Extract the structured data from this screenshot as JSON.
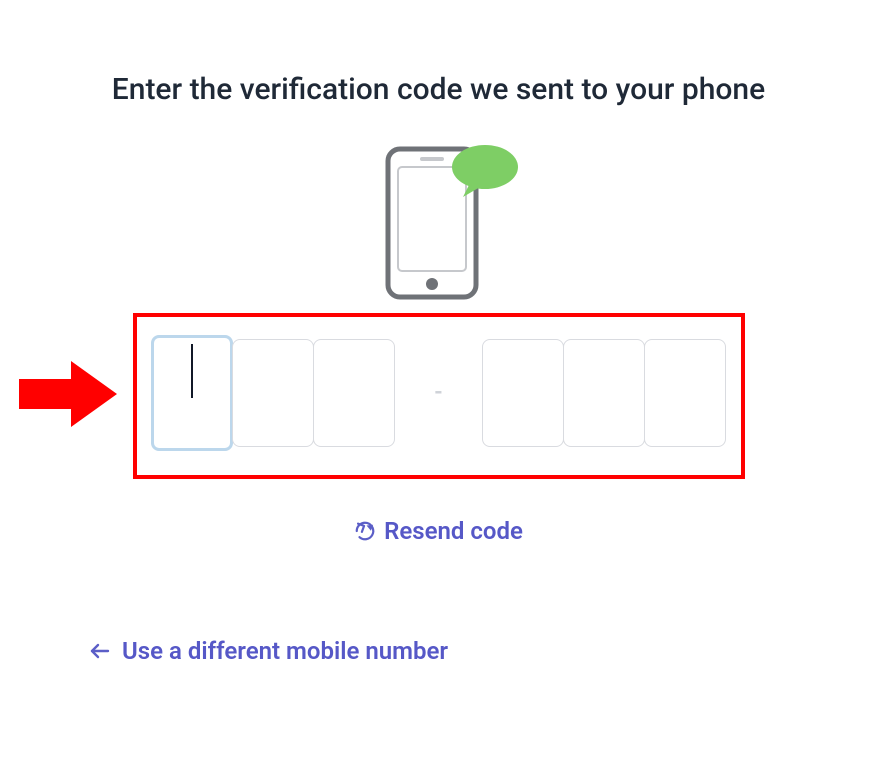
{
  "heading": "Enter the verification code we sent to your phone",
  "code": {
    "separator": "-",
    "digits": [
      "",
      "",
      "",
      "",
      "",
      ""
    ],
    "focused_index": 0
  },
  "resend_label": "Resend code",
  "back_label": "Use a different mobile number",
  "annotation": {
    "highlight": true,
    "arrow": true
  }
}
